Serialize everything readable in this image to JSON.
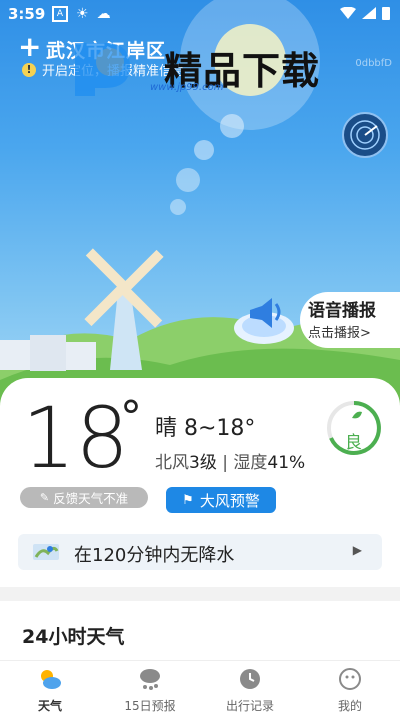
{
  "status_bar": {
    "time": "3:59"
  },
  "header": {
    "location": "武汉市江岸区",
    "location_tip": "开启定位，播报精准信息",
    "watermark_id": "0dbbfD",
    "watermark_logo_text": "精品下载",
    "watermark_logo_url": "www.jp99.com"
  },
  "voice": {
    "title": "语音播报",
    "subtitle": "点击播报>"
  },
  "current": {
    "temperature": "18",
    "degree": "°",
    "condition": "晴 8~18°",
    "wind": "北风",
    "wind_level": "3级",
    "separator": "|",
    "humidity_label": "湿度",
    "humidity": "41%",
    "aqi": "良",
    "feedback_label": "反馈天气不准",
    "alert_label": "大风预警"
  },
  "rain": {
    "text": "在120分钟内无降水",
    "arrow": "▶"
  },
  "section_24h": {
    "title": "24小时天气"
  },
  "tabs": [
    {
      "label": "天气",
      "icon": "partly-sunny-icon"
    },
    {
      "label": "15日预报",
      "icon": "cloud-rain-icon"
    },
    {
      "label": "出行记录",
      "icon": "clock-icon"
    },
    {
      "label": "我的",
      "icon": "smiley-icon"
    }
  ],
  "colors": {
    "accent": "#1e88e5",
    "aqi_green": "#4caf50",
    "sky_top": "#2f8fe6"
  }
}
